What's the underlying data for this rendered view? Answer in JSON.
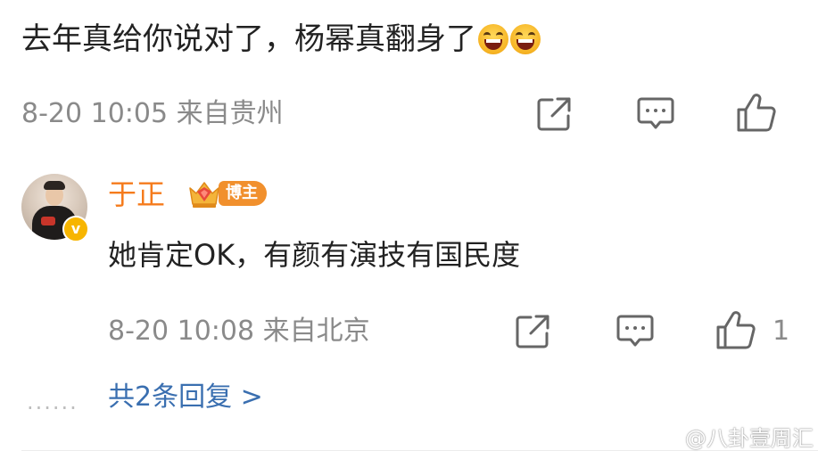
{
  "comment": {
    "text": "去年真给你说对了，杨幂真翻身了",
    "emojis": [
      "laughing-emoji",
      "laughing-emoji"
    ],
    "time": "8-20 10:05",
    "location": "来自贵州"
  },
  "reply": {
    "username": "于正",
    "badge_label": "博主",
    "verified_icon": "v-badge-icon",
    "text": "她肯定OK，有颜有演技有国民度",
    "time": "8-20 10:08",
    "location": "来自北京",
    "like_count": "1"
  },
  "replies_link": {
    "dots": "......",
    "label": "共2条回复",
    "arrow": ">"
  },
  "watermark": {
    "text": "@八卦壹周汇"
  },
  "colors": {
    "username": "#f57b1c",
    "link": "#3a6fb0",
    "meta": "#8a8a8a",
    "badge": "#f1902d"
  }
}
